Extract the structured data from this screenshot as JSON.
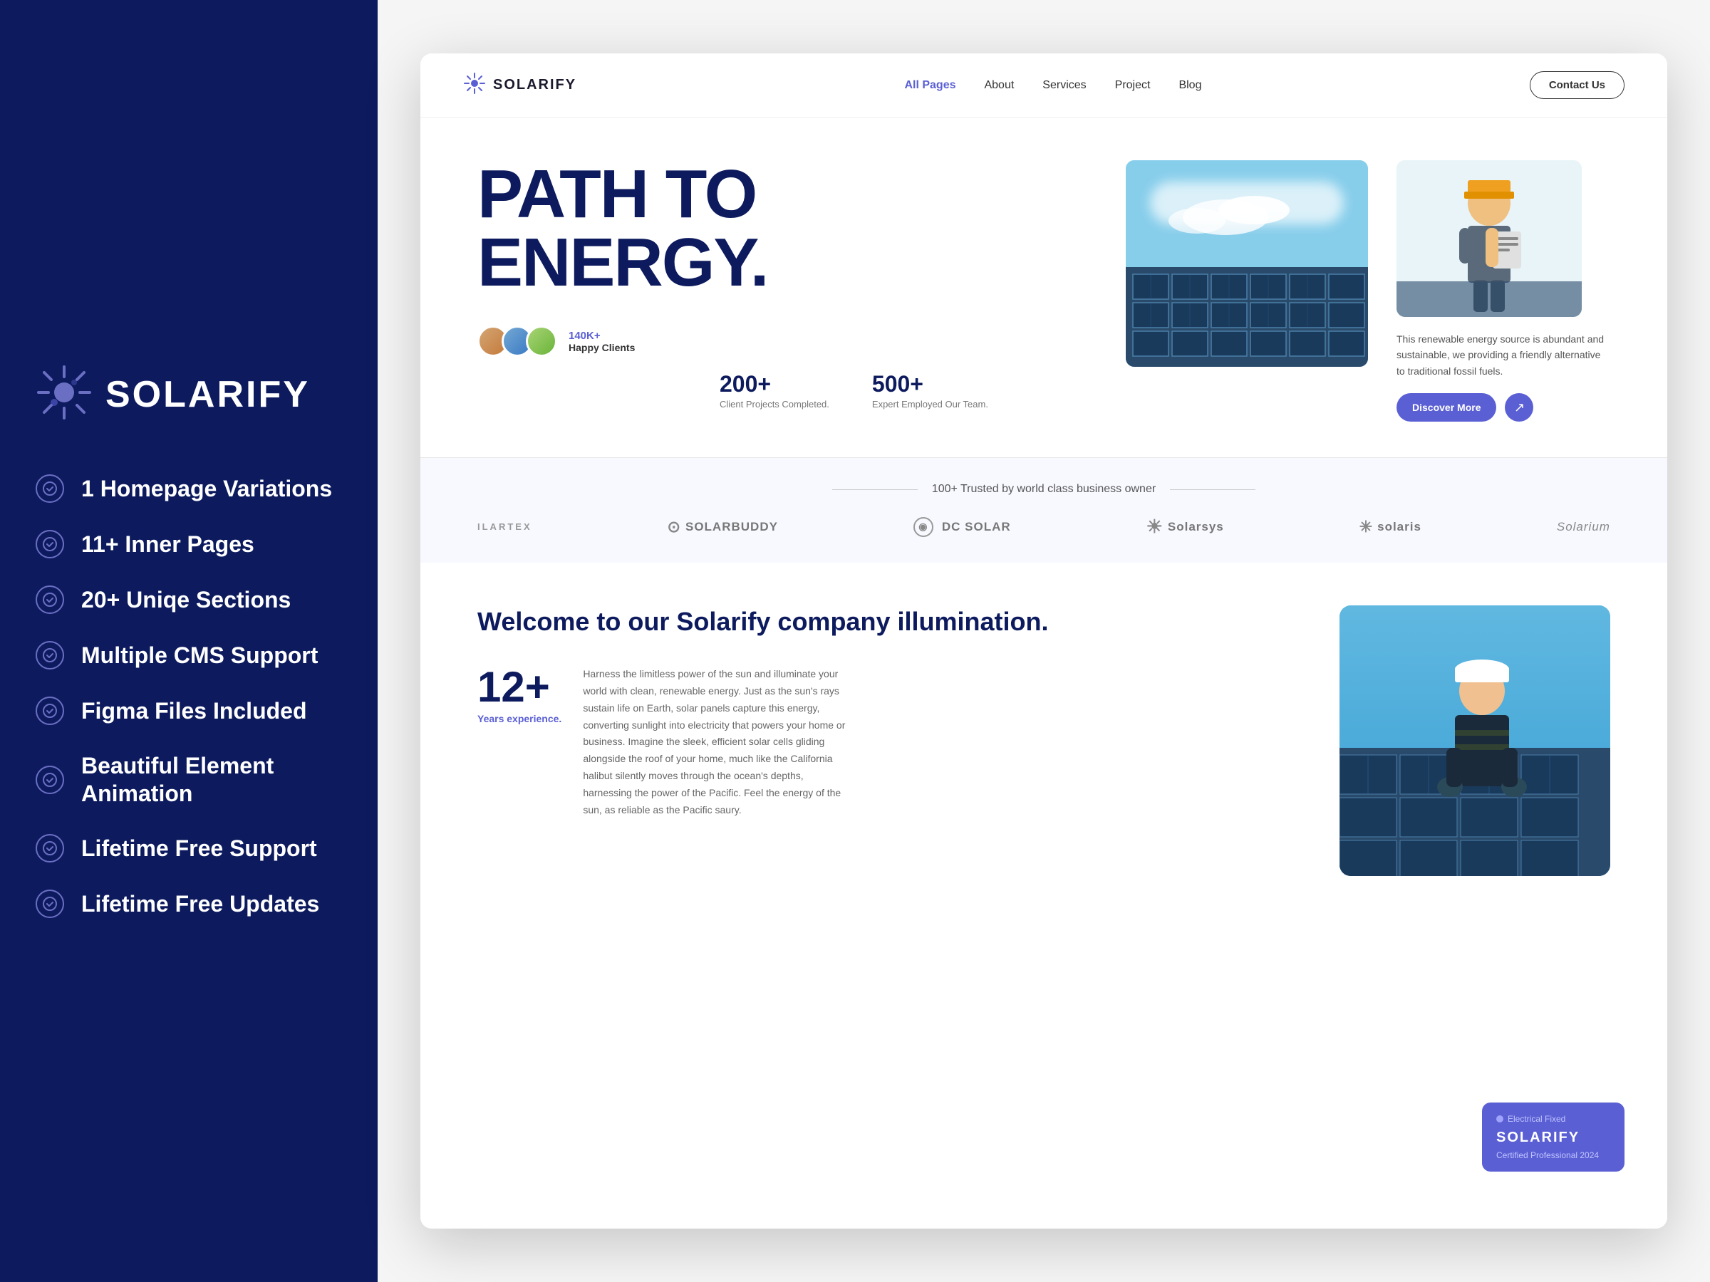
{
  "leftPanel": {
    "logo": {
      "text": "SOLARIFY"
    },
    "features": [
      {
        "label": "1 Homepage Variations"
      },
      {
        "label": "11+ Inner Pages"
      },
      {
        "label": "20+ Uniqe Sections"
      },
      {
        "label": "Multiple CMS Support"
      },
      {
        "label": "Figma Files Included"
      },
      {
        "label": "Beautiful Element Animation"
      },
      {
        "label": "Lifetime Free Support"
      },
      {
        "label": "Lifetime Free Updates"
      }
    ]
  },
  "navbar": {
    "logo": "SOLARIFY",
    "links": [
      {
        "label": "All Pages",
        "active": true
      },
      {
        "label": "About",
        "active": false
      },
      {
        "label": "Services",
        "active": false
      },
      {
        "label": "Project",
        "active": false
      },
      {
        "label": "Blog",
        "active": false
      }
    ],
    "contactBtn": "Contact Us"
  },
  "hero": {
    "title_line1": "PATH TO",
    "title_line2": "ENERGY.",
    "description": "This renewable energy source is abundant and sustainable, we providing a friendly alternative to traditional fossil fuels.",
    "discoverBtn": "Discover More",
    "clientsCount": "140K+",
    "clientsLabel": "Happy Clients",
    "stats": [
      {
        "number": "200+",
        "label": "Client Projects Completed."
      },
      {
        "number": "500+",
        "label": "Expert Employed Our Team."
      }
    ]
  },
  "trusted": {
    "title": "100+ Trusted by world class business owner",
    "brands": [
      {
        "name": "ILARTEX",
        "prefix": ""
      },
      {
        "name": "SOLARBUDDY",
        "prefix": "⊙"
      },
      {
        "name": "DC SOLAR",
        "prefix": "◉"
      },
      {
        "name": "Solarsys",
        "prefix": "S"
      },
      {
        "name": "solaris",
        "prefix": "✳"
      },
      {
        "name": "Solarium",
        "prefix": ""
      }
    ]
  },
  "welcome": {
    "title": "Welcome to our Solarify company illumination.",
    "stat": {
      "number": "12+",
      "label": "Years experience."
    },
    "body": "Harness the limitless power of the sun and illuminate your world with clean, renewable energy. Just as the sun's rays sustain life on Earth, solar panels capture this energy, converting sunlight into electricity that powers your home or business. Imagine the sleek, efficient solar cells gliding alongside the roof of your home, much like the California halibut silently moves through the ocean's depths, harnessing the power of the Pacific. Feel the energy of the sun, as reliable as the Pacific saury.",
    "badge": {
      "tag": "Electrical Fixed",
      "name": "SOLARIFY",
      "sub": "Certified Professional 2024"
    }
  }
}
